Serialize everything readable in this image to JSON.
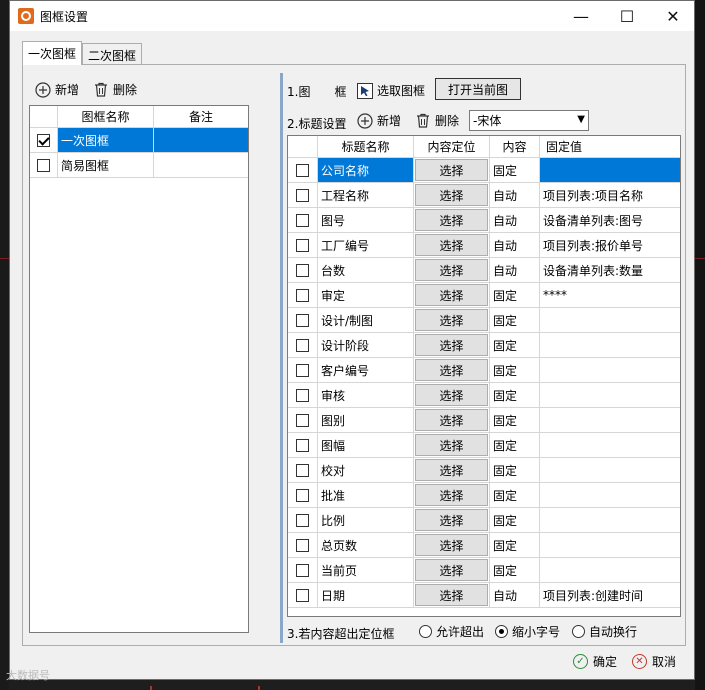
{
  "window": {
    "title": "图框设置",
    "minimize_icon": "—",
    "maximize_icon": "☐",
    "close_icon": "✕"
  },
  "tabs": [
    {
      "label": "一次图框",
      "active": true
    },
    {
      "label": "二次图框",
      "active": false
    }
  ],
  "left": {
    "add_label": "新增",
    "delete_label": "删除",
    "columns": [
      "图框名称",
      "备注"
    ],
    "rows": [
      {
        "checked": true,
        "name": "一次图框",
        "note": "",
        "selected": true
      },
      {
        "checked": false,
        "name": "简易图框",
        "note": "",
        "selected": false
      }
    ]
  },
  "right": {
    "section1_label": "1.图　　框",
    "pick_frame_label": "选取图框",
    "open_current_label": "打开当前图",
    "section2_label": "2.标题设置",
    "add_label": "新增",
    "delete_label": "删除",
    "font_value": "-宋体",
    "columns": [
      "标题名称",
      "内容定位",
      "内容",
      "固定值"
    ],
    "select_label": "选择",
    "rows": [
      {
        "name": "公司名称",
        "content": "固定",
        "value": "",
        "selected": true
      },
      {
        "name": "工程名称",
        "content": "自动",
        "value": "项目列表:项目名称"
      },
      {
        "name": "图号",
        "content": "自动",
        "value": "设备清单列表:图号"
      },
      {
        "name": "工厂编号",
        "content": "自动",
        "value": "项目列表:报价单号"
      },
      {
        "name": "台数",
        "content": "自动",
        "value": "设备清单列表:数量"
      },
      {
        "name": "审定",
        "content": "固定",
        "value": "****"
      },
      {
        "name": "设计/制图",
        "content": "固定",
        "value": ""
      },
      {
        "name": "设计阶段",
        "content": "固定",
        "value": ""
      },
      {
        "name": "客户编号",
        "content": "固定",
        "value": ""
      },
      {
        "name": "审核",
        "content": "固定",
        "value": ""
      },
      {
        "name": "图别",
        "content": "固定",
        "value": ""
      },
      {
        "name": "图幅",
        "content": "固定",
        "value": ""
      },
      {
        "name": "校对",
        "content": "固定",
        "value": ""
      },
      {
        "name": "批准",
        "content": "固定",
        "value": ""
      },
      {
        "name": "比例",
        "content": "固定",
        "value": ""
      },
      {
        "name": "总页数",
        "content": "固定",
        "value": ""
      },
      {
        "name": "当前页",
        "content": "固定",
        "value": ""
      },
      {
        "name": "日期",
        "content": "自动",
        "value": "项目列表:创建时间"
      }
    ],
    "section3_label": "3.若内容超出定位框",
    "options": [
      {
        "label": "允许超出",
        "checked": false
      },
      {
        "label": "缩小字号",
        "checked": true
      },
      {
        "label": "自动换行",
        "checked": false
      }
    ]
  },
  "footer": {
    "ok_label": "确定",
    "cancel_label": "取消",
    "watermark": "大数据号"
  },
  "colors": {
    "selection": "#0078d7",
    "divider": "#8aa6c8"
  }
}
